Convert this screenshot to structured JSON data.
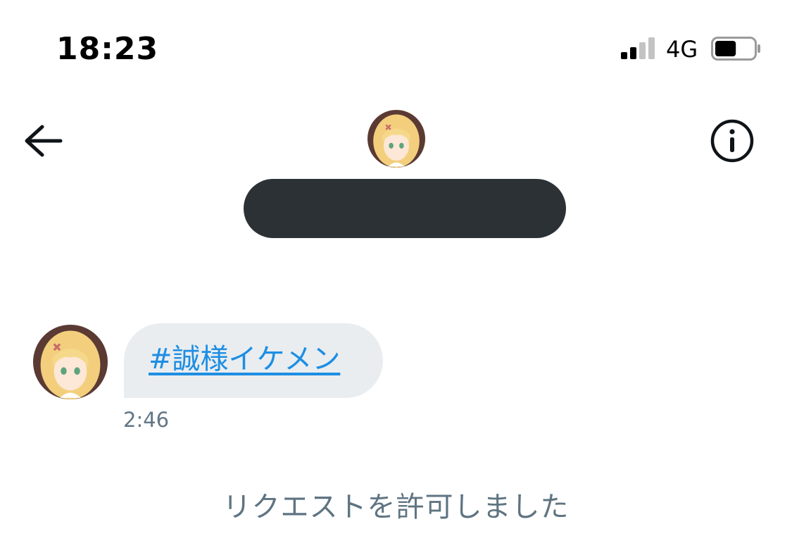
{
  "status_bar": {
    "time": "18:23",
    "network": "4G",
    "signal_icon": "signal-bars-icon",
    "battery_icon": "battery-icon",
    "battery_level": 0.55
  },
  "header": {
    "back_icon": "back-arrow-icon",
    "info_icon": "info-icon",
    "avatar_icon": "avatar",
    "name_redacted": true
  },
  "conversation": {
    "messages": [
      {
        "text": "#誠様イケメン",
        "time": "2:46",
        "is_link": true
      }
    ],
    "system_note": "リクエストを許可しました"
  },
  "colors": {
    "link": "#1d8ee3",
    "bubble": "#e9edf0",
    "muted_text": "#5f7482",
    "redaction": "#2c3135"
  }
}
